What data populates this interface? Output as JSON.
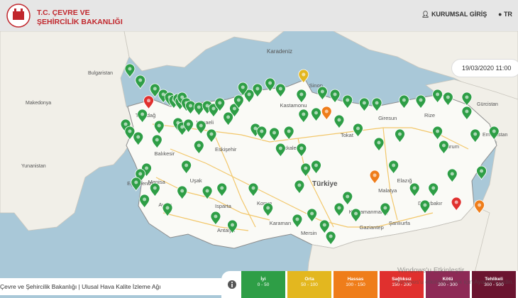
{
  "header": {
    "logo_line1": "T.C. ÇEVRE VE",
    "logo_line2": "ŞEHİRCİLİK BAKANLIĞI",
    "login_label": "KURUMSAL GİRİŞ",
    "language_label": "TR"
  },
  "date_time": "19/03/2020 11:00",
  "footer": {
    "text": "Çevre ve Şehircilik Bakanlığı | Ulusal Hava Kalite İzleme Ağı"
  },
  "watermark": {
    "line1": "Windows'u Etkinleştir",
    "line2": "Windows'u etkinleştirmek için Ayarlar'a gidin."
  },
  "legend": [
    {
      "name": "İyi",
      "range": "0 - 50",
      "color": "#2e9e46"
    },
    {
      "name": "Orta",
      "range": "50 - 100",
      "color": "#e3b71f"
    },
    {
      "name": "Hassas",
      "range": "100 - 150",
      "color": "#ef7d1a"
    },
    {
      "name": "Sağlıksız",
      "range": "150 - 200",
      "color": "#e0302e"
    },
    {
      "name": "Kötü",
      "range": "200 - 300",
      "color": "#8e2a56"
    },
    {
      "name": "Tehlikeli",
      "range": "300 - 500",
      "color": "#6b1430"
    }
  ],
  "map_labels": {
    "sea": "Karadeniz",
    "country": "Türkiye",
    "neighbors": [
      "Bulgaristan",
      "Makedonya",
      "Yunanistan",
      "Gürcistan",
      "Ermenistan"
    ],
    "cities": [
      "Tekirdağ",
      "Kocaeli",
      "Balıkesir",
      "Eskişehir",
      "Manisa",
      "Aydın",
      "Isparta",
      "Antalya",
      "Uşak",
      "Konya",
      "Karaman",
      "Mersin",
      "Kastamonu",
      "Sinop",
      "Kırıkkale",
      "Tokat",
      "Giresun",
      "Rize",
      "Erzurum",
      "Malatya",
      "Elazığ",
      "Diyarbakır",
      "Kahramanmaraş",
      "Gaziantep",
      "Şanlıurfa",
      "Ege Denizi"
    ]
  },
  "stations": [
    {
      "lon": 26.6,
      "lat": 42.1,
      "level": "good"
    },
    {
      "lon": 27.1,
      "lat": 41.7,
      "level": "good"
    },
    {
      "lon": 27.8,
      "lat": 41.4,
      "level": "good"
    },
    {
      "lon": 28.2,
      "lat": 41.2,
      "level": "good"
    },
    {
      "lon": 28.5,
      "lat": 41.1,
      "level": "good"
    },
    {
      "lon": 28.7,
      "lat": 41.0,
      "level": "good"
    },
    {
      "lon": 28.9,
      "lat": 41.05,
      "level": "good"
    },
    {
      "lon": 29.0,
      "lat": 40.95,
      "level": "good"
    },
    {
      "lon": 29.1,
      "lat": 41.1,
      "level": "good"
    },
    {
      "lon": 29.3,
      "lat": 40.9,
      "level": "good"
    },
    {
      "lon": 29.5,
      "lat": 40.8,
      "level": "good"
    },
    {
      "lon": 29.9,
      "lat": 40.75,
      "level": "good"
    },
    {
      "lon": 30.3,
      "lat": 40.8,
      "level": "good"
    },
    {
      "lon": 30.6,
      "lat": 40.7,
      "level": "good"
    },
    {
      "lon": 27.5,
      "lat": 40.98,
      "level": "unhealthy"
    },
    {
      "lon": 27.2,
      "lat": 40.5,
      "level": "good"
    },
    {
      "lon": 26.4,
      "lat": 40.15,
      "level": "good"
    },
    {
      "lon": 26.6,
      "lat": 39.9,
      "level": "good"
    },
    {
      "lon": 27.0,
      "lat": 39.7,
      "level": "good"
    },
    {
      "lon": 27.9,
      "lat": 39.6,
      "level": "good"
    },
    {
      "lon": 28.0,
      "lat": 40.1,
      "level": "good"
    },
    {
      "lon": 28.9,
      "lat": 40.2,
      "level": "good"
    },
    {
      "lon": 29.1,
      "lat": 40.05,
      "level": "good"
    },
    {
      "lon": 29.4,
      "lat": 40.15,
      "level": "good"
    },
    {
      "lon": 30.0,
      "lat": 40.1,
      "level": "good"
    },
    {
      "lon": 30.5,
      "lat": 39.8,
      "level": "good"
    },
    {
      "lon": 29.9,
      "lat": 39.4,
      "level": "good"
    },
    {
      "lon": 31.3,
      "lat": 40.4,
      "level": "good"
    },
    {
      "lon": 31.6,
      "lat": 40.7,
      "level": "good"
    },
    {
      "lon": 32.3,
      "lat": 41.2,
      "level": "good"
    },
    {
      "lon": 32.7,
      "lat": 41.4,
      "level": "good"
    },
    {
      "lon": 33.3,
      "lat": 41.6,
      "level": "good"
    },
    {
      "lon": 33.8,
      "lat": 41.4,
      "level": "good"
    },
    {
      "lon": 34.9,
      "lat": 41.9,
      "level": "moderate"
    },
    {
      "lon": 34.8,
      "lat": 41.2,
      "level": "good"
    },
    {
      "lon": 35.8,
      "lat": 41.3,
      "level": "good"
    },
    {
      "lon": 36.4,
      "lat": 41.2,
      "level": "good"
    },
    {
      "lon": 37.0,
      "lat": 41.0,
      "level": "good"
    },
    {
      "lon": 37.8,
      "lat": 40.9,
      "level": "good"
    },
    {
      "lon": 38.4,
      "lat": 40.9,
      "level": "good"
    },
    {
      "lon": 39.7,
      "lat": 41.0,
      "level": "good"
    },
    {
      "lon": 40.5,
      "lat": 41.0,
      "level": "good"
    },
    {
      "lon": 41.3,
      "lat": 41.2,
      "level": "good"
    },
    {
      "lon": 41.8,
      "lat": 41.1,
      "level": "good"
    },
    {
      "lon": 42.7,
      "lat": 41.1,
      "level": "good"
    },
    {
      "lon": 36.0,
      "lat": 40.6,
      "level": "sensitive"
    },
    {
      "lon": 35.5,
      "lat": 40.55,
      "level": "good"
    },
    {
      "lon": 34.9,
      "lat": 40.5,
      "level": "good"
    },
    {
      "lon": 36.6,
      "lat": 40.3,
      "level": "good"
    },
    {
      "lon": 37.5,
      "lat": 40.0,
      "level": "good"
    },
    {
      "lon": 32.6,
      "lat": 40.0,
      "level": "good"
    },
    {
      "lon": 32.9,
      "lat": 39.9,
      "level": "good"
    },
    {
      "lon": 33.5,
      "lat": 39.85,
      "level": "good"
    },
    {
      "lon": 34.2,
      "lat": 39.9,
      "level": "good"
    },
    {
      "lon": 34.8,
      "lat": 39.3,
      "level": "good"
    },
    {
      "lon": 33.8,
      "lat": 39.3,
      "level": "good"
    },
    {
      "lon": 35.5,
      "lat": 38.7,
      "level": "good"
    },
    {
      "lon": 35.0,
      "lat": 38.6,
      "level": "good"
    },
    {
      "lon": 34.7,
      "lat": 38.0,
      "level": "good"
    },
    {
      "lon": 32.5,
      "lat": 37.9,
      "level": "good"
    },
    {
      "lon": 33.2,
      "lat": 37.2,
      "level": "good"
    },
    {
      "lon": 31.0,
      "lat": 37.9,
      "level": "good"
    },
    {
      "lon": 30.3,
      "lat": 37.8,
      "level": "good"
    },
    {
      "lon": 29.1,
      "lat": 37.8,
      "level": "good"
    },
    {
      "lon": 29.3,
      "lat": 38.7,
      "level": "good"
    },
    {
      "lon": 27.4,
      "lat": 38.6,
      "level": "good"
    },
    {
      "lon": 27.1,
      "lat": 38.4,
      "level": "good"
    },
    {
      "lon": 26.9,
      "lat": 38.1,
      "level": "good"
    },
    {
      "lon": 27.8,
      "lat": 37.9,
      "level": "good"
    },
    {
      "lon": 27.3,
      "lat": 37.5,
      "level": "good"
    },
    {
      "lon": 28.4,
      "lat": 37.2,
      "level": "good"
    },
    {
      "lon": 30.7,
      "lat": 36.9,
      "level": "good"
    },
    {
      "lon": 31.5,
      "lat": 36.6,
      "level": "good"
    },
    {
      "lon": 34.6,
      "lat": 36.8,
      "level": "good"
    },
    {
      "lon": 35.3,
      "lat": 37.0,
      "level": "good"
    },
    {
      "lon": 35.9,
      "lat": 36.6,
      "level": "good"
    },
    {
      "lon": 36.2,
      "lat": 36.2,
      "level": "good"
    },
    {
      "lon": 36.6,
      "lat": 37.2,
      "level": "good"
    },
    {
      "lon": 37.0,
      "lat": 37.6,
      "level": "good"
    },
    {
      "lon": 37.4,
      "lat": 37.0,
      "level": "good"
    },
    {
      "lon": 38.3,
      "lat": 38.35,
      "level": "sensitive"
    },
    {
      "lon": 38.8,
      "lat": 37.2,
      "level": "good"
    },
    {
      "lon": 39.2,
      "lat": 38.7,
      "level": "good"
    },
    {
      "lon": 40.2,
      "lat": 37.9,
      "level": "good"
    },
    {
      "lon": 40.7,
      "lat": 37.3,
      "level": "good"
    },
    {
      "lon": 41.1,
      "lat": 37.9,
      "level": "good"
    },
    {
      "lon": 42.0,
      "lat": 38.4,
      "level": "good"
    },
    {
      "lon": 42.2,
      "lat": 37.4,
      "level": "unhealthy"
    },
    {
      "lon": 43.3,
      "lat": 37.3,
      "level": "sensitive"
    },
    {
      "lon": 43.4,
      "lat": 38.5,
      "level": "good"
    },
    {
      "lon": 41.3,
      "lat": 39.9,
      "level": "good"
    },
    {
      "lon": 41.6,
      "lat": 39.4,
      "level": "good"
    },
    {
      "lon": 39.5,
      "lat": 39.8,
      "level": "good"
    },
    {
      "lon": 38.5,
      "lat": 39.5,
      "level": "good"
    },
    {
      "lon": 42.7,
      "lat": 40.6,
      "level": "good"
    },
    {
      "lon": 43.1,
      "lat": 39.8,
      "level": "good"
    },
    {
      "lon": 44.0,
      "lat": 39.9,
      "level": "good"
    },
    {
      "lon": 32.0,
      "lat": 41.45,
      "level": "good"
    },
    {
      "lon": 31.8,
      "lat": 41.0,
      "level": "good"
    },
    {
      "lon": 30.9,
      "lat": 40.9,
      "level": "good"
    }
  ]
}
